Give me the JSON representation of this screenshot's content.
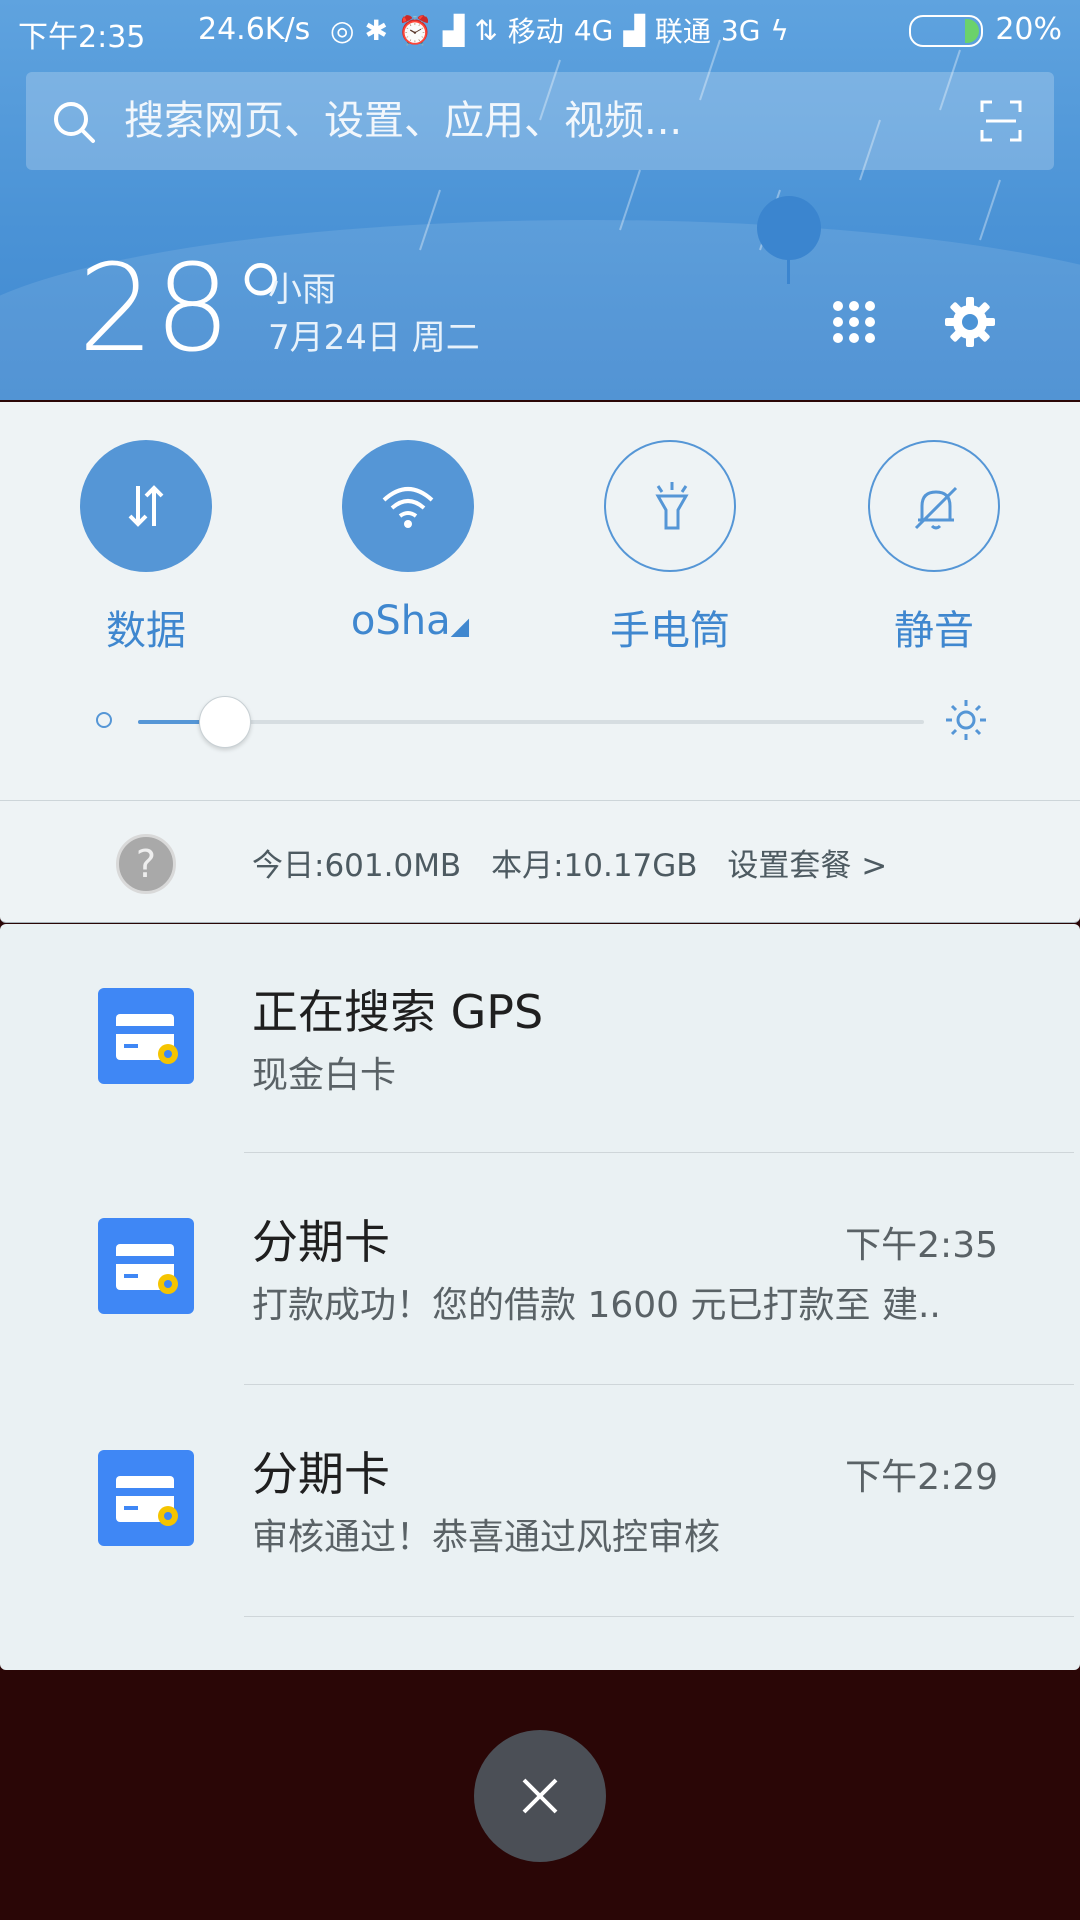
{
  "status_bar": {
    "time": "下午2:35",
    "speed": "24.6K/s",
    "carrier1": "移动",
    "network1": "4G",
    "carrier2": "联通",
    "network2": "3G",
    "battery": "20%"
  },
  "search": {
    "placeholder": "搜索网页、设置、应用、视频..."
  },
  "weather": {
    "temp": "28°",
    "desc": "小雨",
    "date": "7月24日 周二"
  },
  "toggles": [
    {
      "label": "数据",
      "icon": "data-arrows-icon",
      "state": "on"
    },
    {
      "label": "oSha",
      "icon": "wifi-icon",
      "state": "on"
    },
    {
      "label": "手电筒",
      "icon": "flashlight-icon",
      "state": "off"
    },
    {
      "label": "静音",
      "icon": "bell-mute-icon",
      "state": "off"
    }
  ],
  "brightness": {
    "level": 0.11
  },
  "data_usage": {
    "today": "今日:601.0MB",
    "month": "本月:10.17GB",
    "plan": "设置套餐 >"
  },
  "notifications": [
    {
      "title": "正在搜索 GPS",
      "body": "现金白卡",
      "time": ""
    },
    {
      "title": "分期卡",
      "body": "打款成功！您的借款 1600 元已打款至 建..",
      "time": "下午2:35"
    },
    {
      "title": "分期卡",
      "body": "审核通过！恭喜通过风控审核",
      "time": "下午2:29"
    }
  ],
  "colors": {
    "accent": "#5596d6",
    "header": "#4b93d6",
    "app_icon": "#3f87f5",
    "backdrop": "#2a0606"
  }
}
